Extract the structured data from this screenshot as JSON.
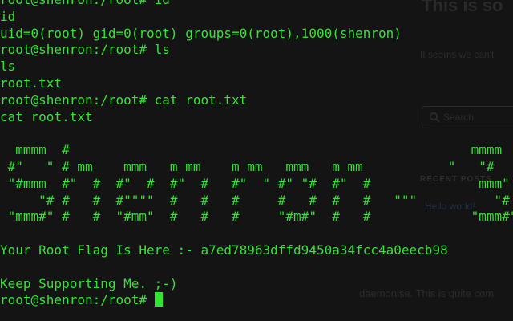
{
  "background_page": {
    "title": "This is so",
    "notice": "It seems we can't",
    "search_placeholder": "Search",
    "search_icon": "search-icon",
    "recent_posts_heading": "RECENT POSTS",
    "recent_post_link": "Hello world!",
    "footer_text": "daemonise. This is quite com"
  },
  "terminal": {
    "prompt": "root@shenron:/root#",
    "text_color": "#34e334",
    "background_color": "#141414",
    "lines": [
      "root@shenron:/root# id",
      "id",
      "uid=0(root) gid=0(root) groups=0(root),1000(shenron)",
      "root@shenron:/root# ls",
      "ls",
      "root.txt",
      "root@shenron:/root# cat root.txt",
      "cat root.txt",
      "",
      "  mmmm  #                                                    mmmm",
      " #\"   \" # mm    mmm   m mm    m mm   mmm   m mm           \"   \"#",
      " \"#mmm  #\"  #  #\"  #  #\"  #   #\"  \" #\" \"#  #\"  #              mmm\"",
      "     \"# #   #  #\"\"\"\"  #   #   #     #   #  #   #   \"\"\"          \"#",
      " \"mmm#\" #   #  \"#mm\"  #   #   #     \"#m#\"  #   #             \"mmm#\"",
      "",
      "Your Root Flag Is Here :- a7ed78963dffd9450a34fcc4a0eecb98",
      "",
      "Keep Supporting Me. ;-)"
    ],
    "current_prompt": "root@shenron:/root# "
  }
}
